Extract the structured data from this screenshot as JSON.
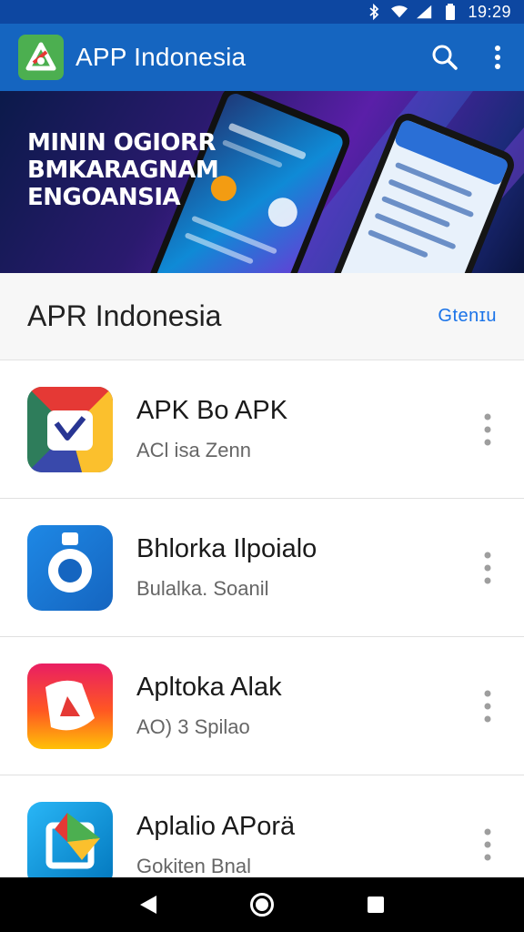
{
  "status_bar": {
    "time": "19:29",
    "icons": [
      "bluetooth-icon",
      "wifi-icon",
      "signal-icon",
      "battery-icon"
    ]
  },
  "app_bar": {
    "title": "APP Indonesia",
    "logo_icon": "app-logo-icon",
    "actions": [
      "search-icon",
      "more-vert-icon"
    ],
    "color": "#1565c0"
  },
  "banner": {
    "lines": [
      "MININ OGIORR",
      "BMKARAGNAM",
      "ENGOANSIA"
    ]
  },
  "section": {
    "title": "APR Indonesia",
    "link": "Gtenɪu"
  },
  "apps": [
    {
      "title": "APK Bo APK",
      "subtitle": "ACl isa Zenn",
      "icon": "check-app-icon"
    },
    {
      "title": "Bhlorka Ilpoialo",
      "subtitle": "Bulalka. Soanil",
      "icon": "ring-app-icon"
    },
    {
      "title": "Apltoka Alak",
      "subtitle": "AO) 3 Spilao",
      "icon": "triangle-app-icon"
    },
    {
      "title": "Aplalio APorä",
      "subtitle": "Gokiten Bnal",
      "icon": "play-app-icon"
    }
  ],
  "nav_bar": {
    "buttons": [
      "back-icon",
      "home-icon",
      "recents-icon"
    ]
  },
  "colors": {
    "accent": "#1a73e8",
    "status_bar": "#0d47a1",
    "app_bar": "#1565c0"
  }
}
